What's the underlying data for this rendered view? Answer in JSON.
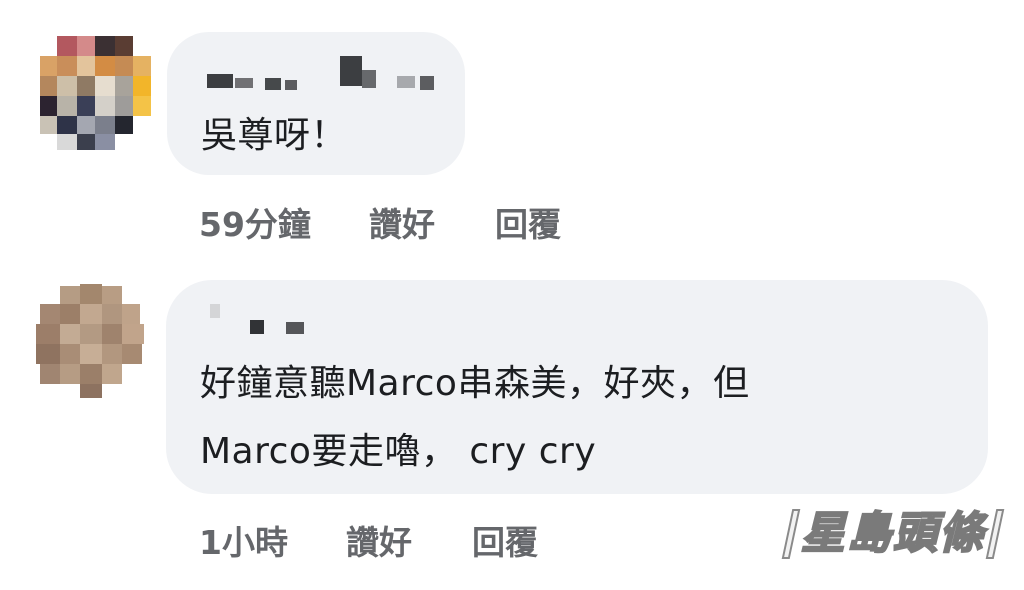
{
  "comments": [
    {
      "author": "",
      "text": "吳尊呀！",
      "time": "59分鐘",
      "like_label": "讚好",
      "reply_label": "回覆"
    },
    {
      "author": "",
      "text_lines": [
        "好鐘意聽Marco串森美，好夾，但",
        "Marco要走嚕， cry cry"
      ],
      "time": "1小時",
      "like_label": "讚好",
      "reply_label": "回覆"
    }
  ],
  "watermark": {
    "text": "星島頭條"
  },
  "colors": {
    "bubble": "#f0f2f5",
    "text": "#1c1e21",
    "meta": "#65676b"
  }
}
